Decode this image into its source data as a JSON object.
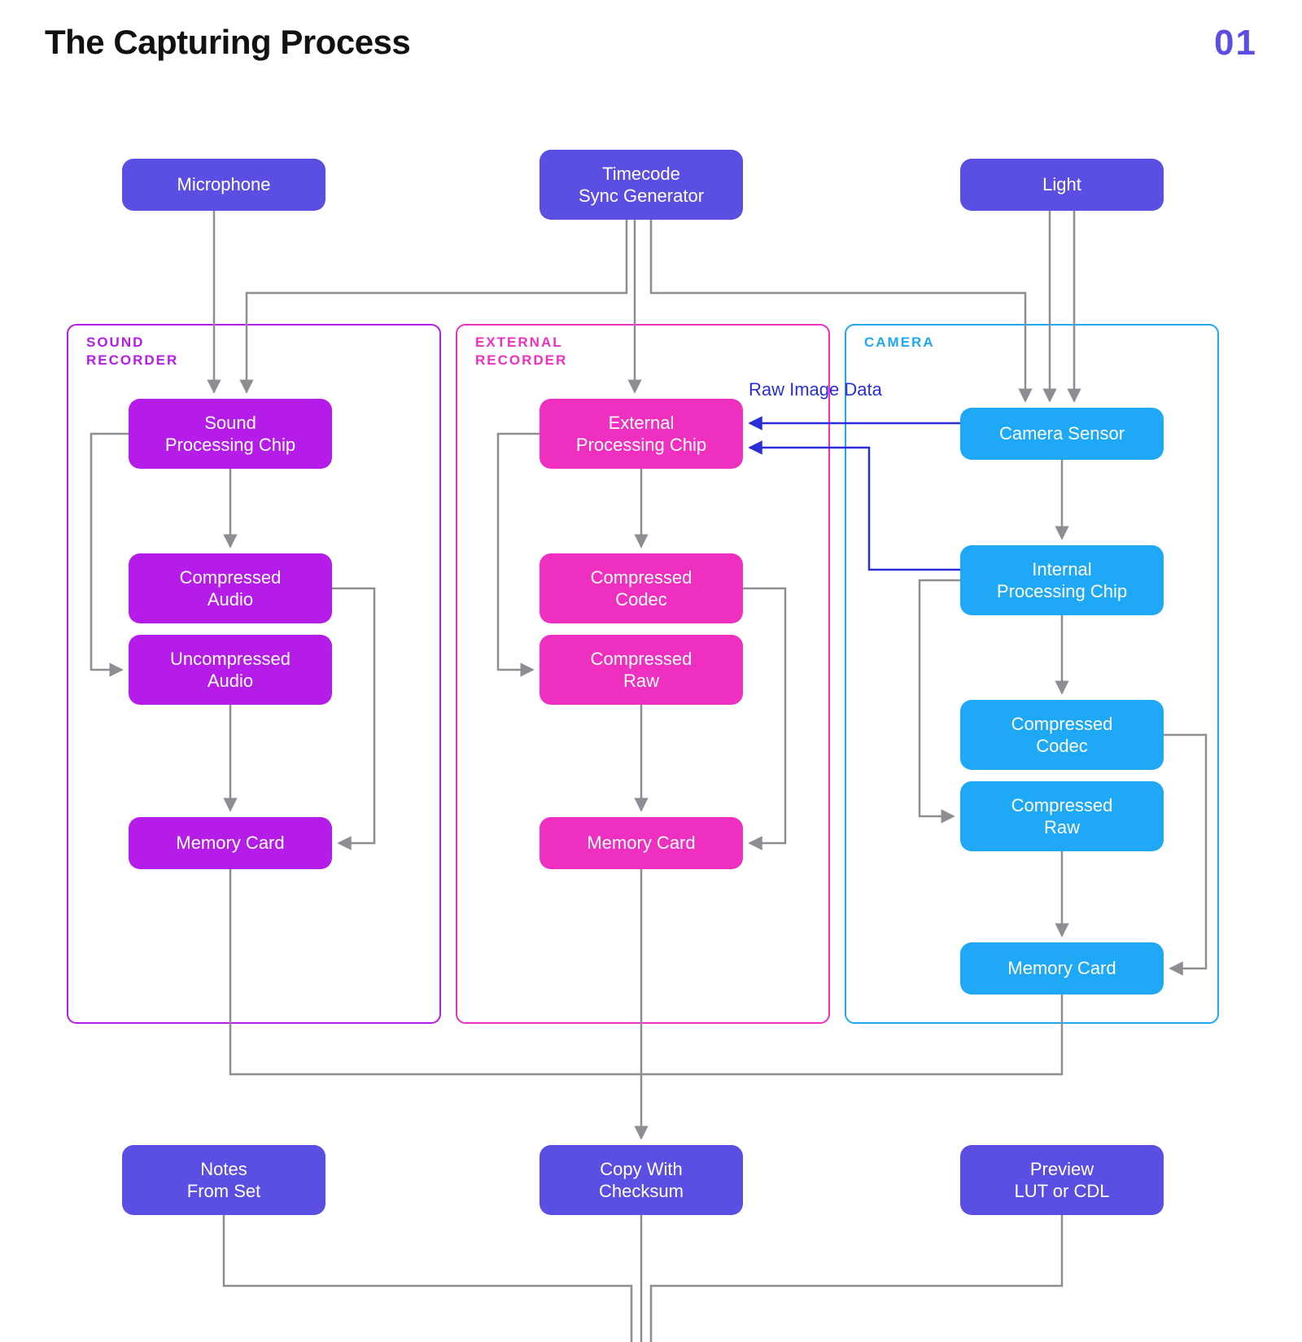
{
  "header": {
    "title": "The Capturing Process",
    "page_number": "01"
  },
  "inputs": {
    "microphone": "Microphone",
    "timecode": "Timecode\nSync Generator",
    "light": "Light"
  },
  "groups": {
    "sound": {
      "label": "SOUND\nRECORDER"
    },
    "external": {
      "label": "EXTERNAL\nRECORDER"
    },
    "camera": {
      "label": "CAMERA"
    }
  },
  "sound": {
    "chip": "Sound\nProcessing Chip",
    "compressed": "Compressed\nAudio",
    "uncompressed": "Uncompressed\nAudio",
    "memory": "Memory Card"
  },
  "external": {
    "chip": "External\nProcessing Chip",
    "codec": "Compressed\nCodec",
    "raw": "Compressed\nRaw",
    "memory": "Memory Card"
  },
  "camera": {
    "sensor": "Camera Sensor",
    "chip": "Internal\nProcessing Chip",
    "codec": "Compressed\nCodec",
    "raw": "Compressed\nRaw",
    "memory": "Memory Card"
  },
  "annotations": {
    "raw_image_data": "Raw Image Data"
  },
  "outputs": {
    "notes": "Notes\nFrom Set",
    "copy": "Copy With\nChecksum",
    "preview": "Preview\nLUT or CDL"
  },
  "colors": {
    "indigo": "#5b4ee3",
    "purple": "#b51ce8",
    "magenta": "#ee2fc0",
    "cyan": "#1ea8f5",
    "arrow_gray": "#8d8d93",
    "arrow_blue": "#2a2ed8"
  }
}
